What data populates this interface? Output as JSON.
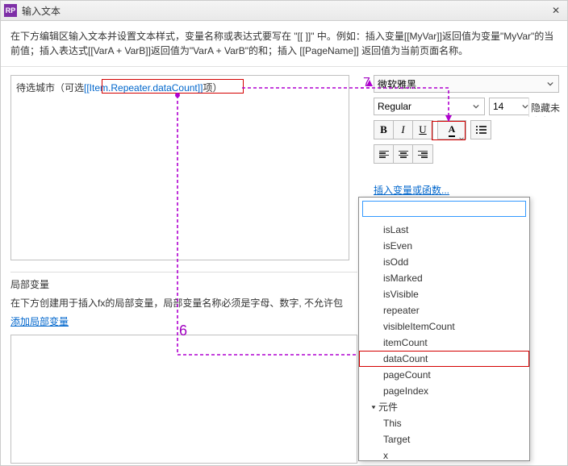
{
  "titlebar": {
    "app_icon_label": "RP",
    "title": "输入文本",
    "close_label": "✕"
  },
  "instructions": "在下方编辑区输入文本并设置文本样式，变量名称或表达式要写在 \"[[ ]]\" 中。例如：插入变量[[MyVar]]返回值为变量\"MyVar\"的当前值；插入表达式[[VarA + VarB]]返回值为\"VarA + VarB\"的和；插入 [[PageName]] 返回值为当前页面名称。",
  "editor": {
    "prefix": "待选城市（可选",
    "expression": "[[Item.Repeater.dataCount]]",
    "suffix": "项）"
  },
  "format": {
    "font": "微软雅黑",
    "weight": "Regular",
    "size": "14",
    "buttons": {
      "bold": "B",
      "italic": "I",
      "underline": "U"
    }
  },
  "insert_link": "插入变量或函数...",
  "localvars": {
    "header": "局部变量",
    "desc": "在下方创建用于插入fx的局部变量，局部变量名称必须是字母、数字, 不允许包",
    "add_link": "添加局部变量"
  },
  "dropdown": {
    "search_value": "",
    "items": [
      {
        "label": "isLast",
        "type": "item"
      },
      {
        "label": "isEven",
        "type": "item"
      },
      {
        "label": "isOdd",
        "type": "item"
      },
      {
        "label": "isMarked",
        "type": "item"
      },
      {
        "label": "isVisible",
        "type": "item"
      },
      {
        "label": "repeater",
        "type": "item"
      },
      {
        "label": "visibleItemCount",
        "type": "item"
      },
      {
        "label": "itemCount",
        "type": "item"
      },
      {
        "label": "dataCount",
        "type": "item",
        "selected": true
      },
      {
        "label": "pageCount",
        "type": "item"
      },
      {
        "label": "pageIndex",
        "type": "item"
      },
      {
        "label": "元件",
        "type": "category"
      },
      {
        "label": "This",
        "type": "item"
      },
      {
        "label": "Target",
        "type": "item"
      },
      {
        "label": "x",
        "type": "item"
      }
    ]
  },
  "annotations": {
    "num7": "7",
    "num6": "6"
  },
  "side_hidden_label": "隐藏未命名"
}
